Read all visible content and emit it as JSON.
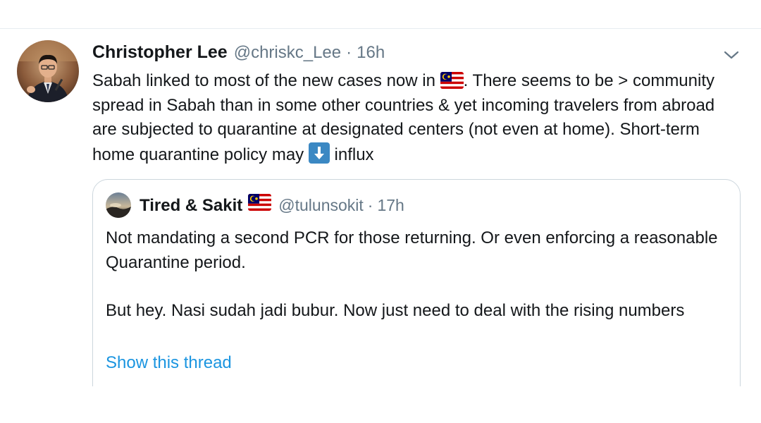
{
  "tweet": {
    "author_name": "Christopher Lee",
    "author_handle": "@chriskc_Lee",
    "separator": "·",
    "time": "16h",
    "text_part1": "Sabah linked to most of the new cases now in",
    "flag_icon": "malaysia-flag-icon",
    "text_part2": ". There seems to be > community spread in Sabah than in some other countries & yet incoming travelers from abroad are subjected to quarantine at designated centers (not even at home). Short-term home quarantine  policy may",
    "down_icon": "down-arrow-emoji-icon",
    "text_part3": "influx",
    "menu_icon": "chevron-down-icon"
  },
  "quote": {
    "author_name": "Tired & Sakit",
    "author_flag_icon": "malaysia-flag-icon",
    "author_handle": "@tulunsokit",
    "separator": "·",
    "time": "17h",
    "paragraph1": "Not mandating a second PCR for those returning. Or even enforcing a reasonable Quarantine period.",
    "paragraph2": "But hey. Nasi sudah jadi bubur. Now just need to deal with the rising numbers",
    "show_thread_label": "Show this thread"
  },
  "colors": {
    "text_primary": "#14171a",
    "text_secondary": "#657786",
    "link": "#1b95e0",
    "border": "#ccd6dd"
  }
}
